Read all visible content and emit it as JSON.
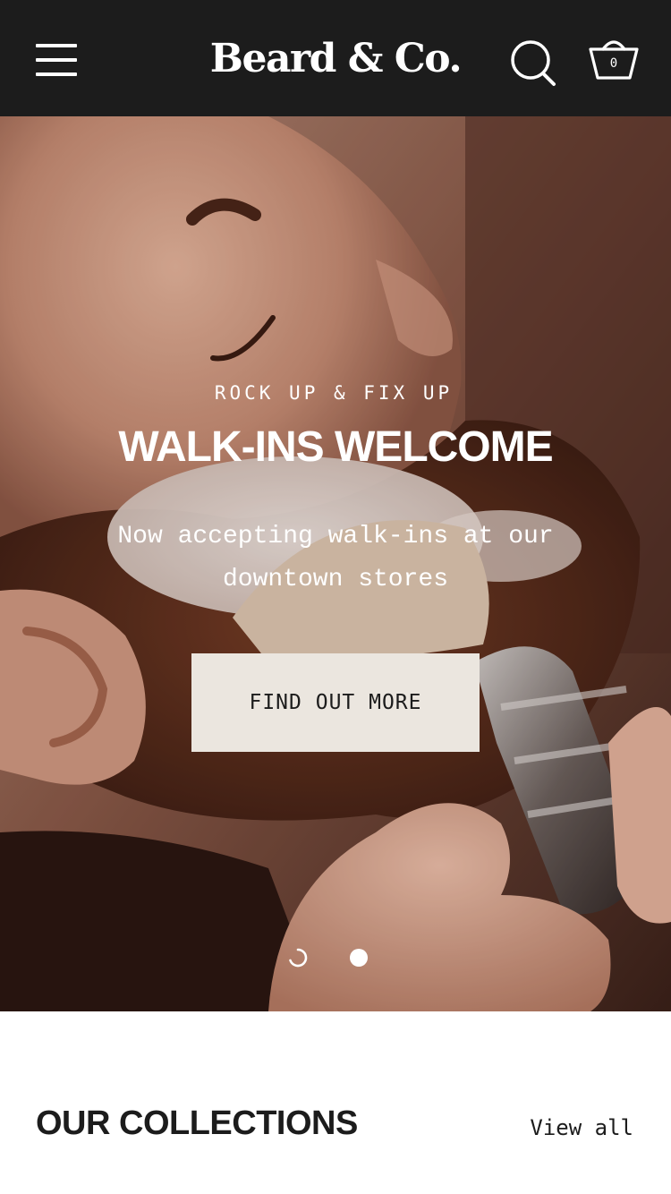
{
  "header": {
    "brand": "Beard & Co.",
    "cart_count": "0",
    "icons": {
      "menu": "hamburger-menu-icon",
      "search": "search-icon",
      "cart": "basket-icon"
    },
    "background_color": "#1c1c1c"
  },
  "hero": {
    "eyebrow": "ROCK UP & FIX UP",
    "title": "WALK-INS WELCOME",
    "subtitle": "Now accepting walk-ins at our downtown stores",
    "cta_label": "FIND OUT MORE",
    "cta_color": "#ebe6df",
    "slides": {
      "count": 2,
      "active_index": 2
    }
  },
  "collections": {
    "heading": "OUR COLLECTIONS",
    "view_all_label": "View all"
  }
}
